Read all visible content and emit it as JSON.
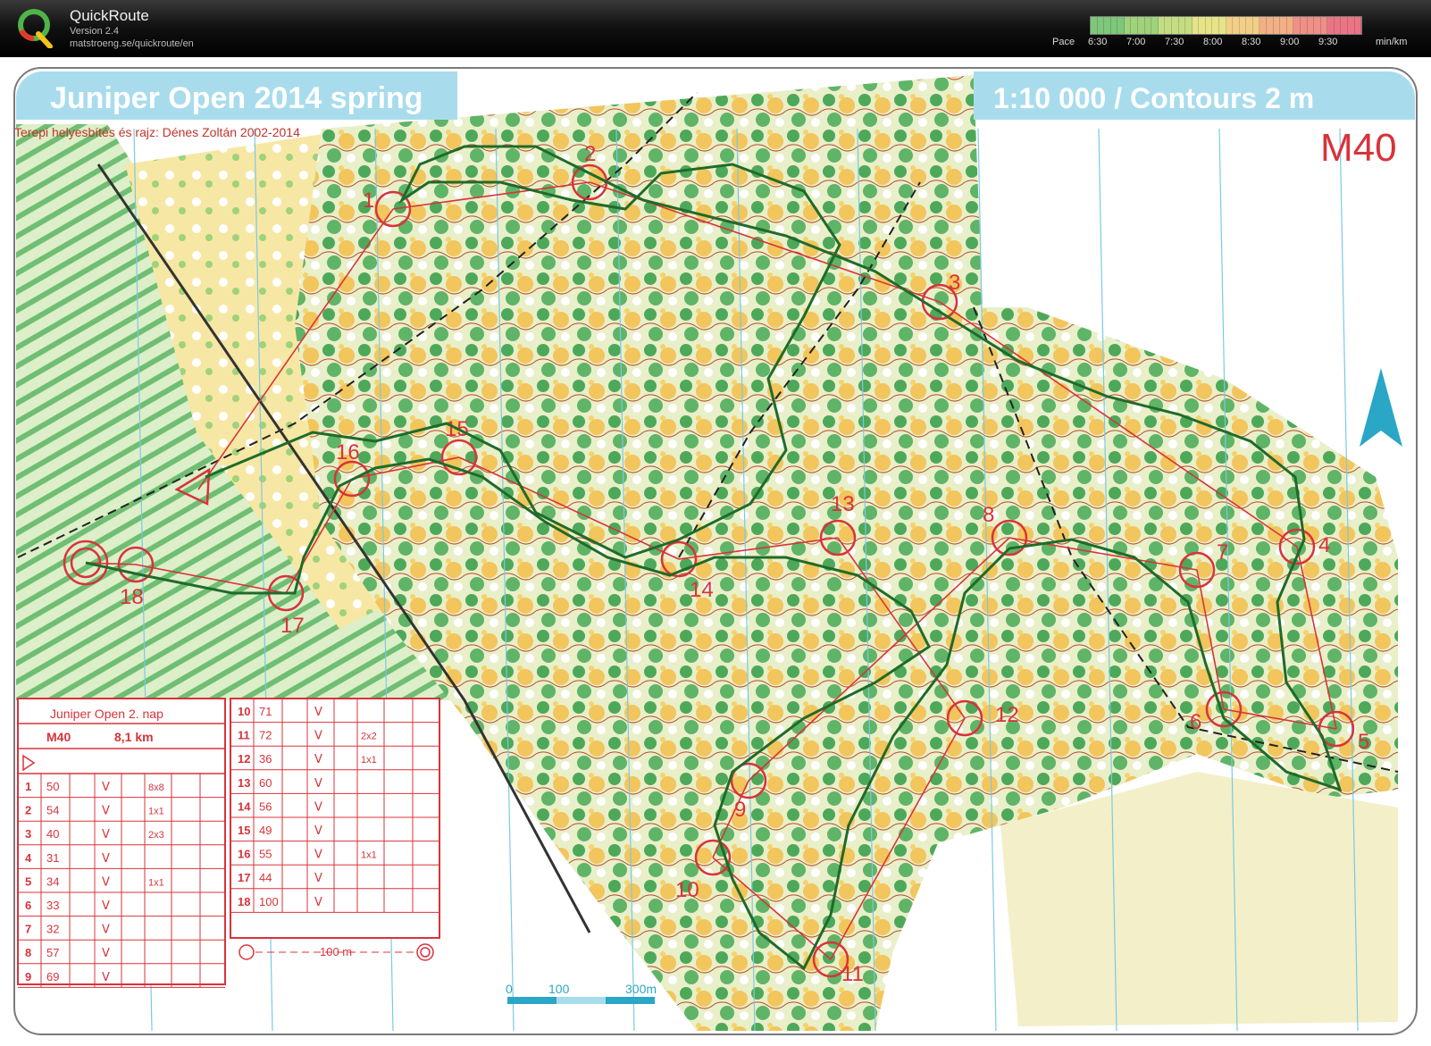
{
  "app": {
    "title": "QuickRoute",
    "version": "Version 2.4",
    "url": "matstroeng.se/quickroute/en",
    "logo_letter": "Q"
  },
  "pace": {
    "label": "Pace",
    "ticks": [
      "6:30",
      "7:00",
      "7:30",
      "8:00",
      "8:30",
      "9:00",
      "9:30"
    ],
    "unit": "min/km",
    "gradient_colors": [
      "#7fc77a",
      "#9fd27b",
      "#c5dd82",
      "#e7e389",
      "#f2cf86",
      "#f1b085",
      "#ee9087",
      "#ea7585"
    ]
  },
  "map": {
    "title": "Juniper Open 2014 spring",
    "scale_text": "1:10 000 / Contours 2 m",
    "credit": "Terepi helyesbítés és rajz: Dénes Zoltán 2002-2014",
    "class_label": "M40",
    "scale_bar_labels": [
      "0",
      "100",
      "300m"
    ],
    "controls": [
      {
        "label": "1"
      },
      {
        "label": "2"
      },
      {
        "label": "3"
      },
      {
        "label": "4"
      },
      {
        "label": "5"
      },
      {
        "label": "6"
      },
      {
        "label": "7"
      },
      {
        "label": "8"
      },
      {
        "label": "9"
      },
      {
        "label": "10"
      },
      {
        "label": "11"
      },
      {
        "label": "12"
      },
      {
        "label": "13"
      },
      {
        "label": "14"
      },
      {
        "label": "15"
      },
      {
        "label": "16"
      },
      {
        "label": "17"
      },
      {
        "label": "18"
      }
    ]
  },
  "description_sheet": {
    "title": "Juniper Open 2. nap",
    "class": "M40",
    "length": "8,1 km",
    "scale_note": "100 m",
    "rows_left": [
      {
        "n": "1",
        "code": "50",
        "extra": "8x8"
      },
      {
        "n": "2",
        "code": "54",
        "extra": "1x1"
      },
      {
        "n": "3",
        "code": "40",
        "extra": "2x3"
      },
      {
        "n": "4",
        "code": "31",
        "extra": ""
      },
      {
        "n": "5",
        "code": "34",
        "extra": "1x1"
      },
      {
        "n": "6",
        "code": "33",
        "extra": ""
      },
      {
        "n": "7",
        "code": "32",
        "extra": ""
      },
      {
        "n": "8",
        "code": "57",
        "extra": ""
      },
      {
        "n": "9",
        "code": "69",
        "extra": ""
      }
    ],
    "rows_right": [
      {
        "n": "10",
        "code": "71",
        "extra": ""
      },
      {
        "n": "11",
        "code": "72",
        "extra": "2x2"
      },
      {
        "n": "12",
        "code": "36",
        "extra": "1x1"
      },
      {
        "n": "13",
        "code": "60",
        "extra": ""
      },
      {
        "n": "14",
        "code": "56",
        "extra": ""
      },
      {
        "n": "15",
        "code": "49",
        "extra": ""
      },
      {
        "n": "16",
        "code": "55",
        "extra": "1x1"
      },
      {
        "n": "17",
        "code": "44",
        "extra": ""
      },
      {
        "n": "18",
        "code": "100",
        "extra": ""
      }
    ]
  }
}
